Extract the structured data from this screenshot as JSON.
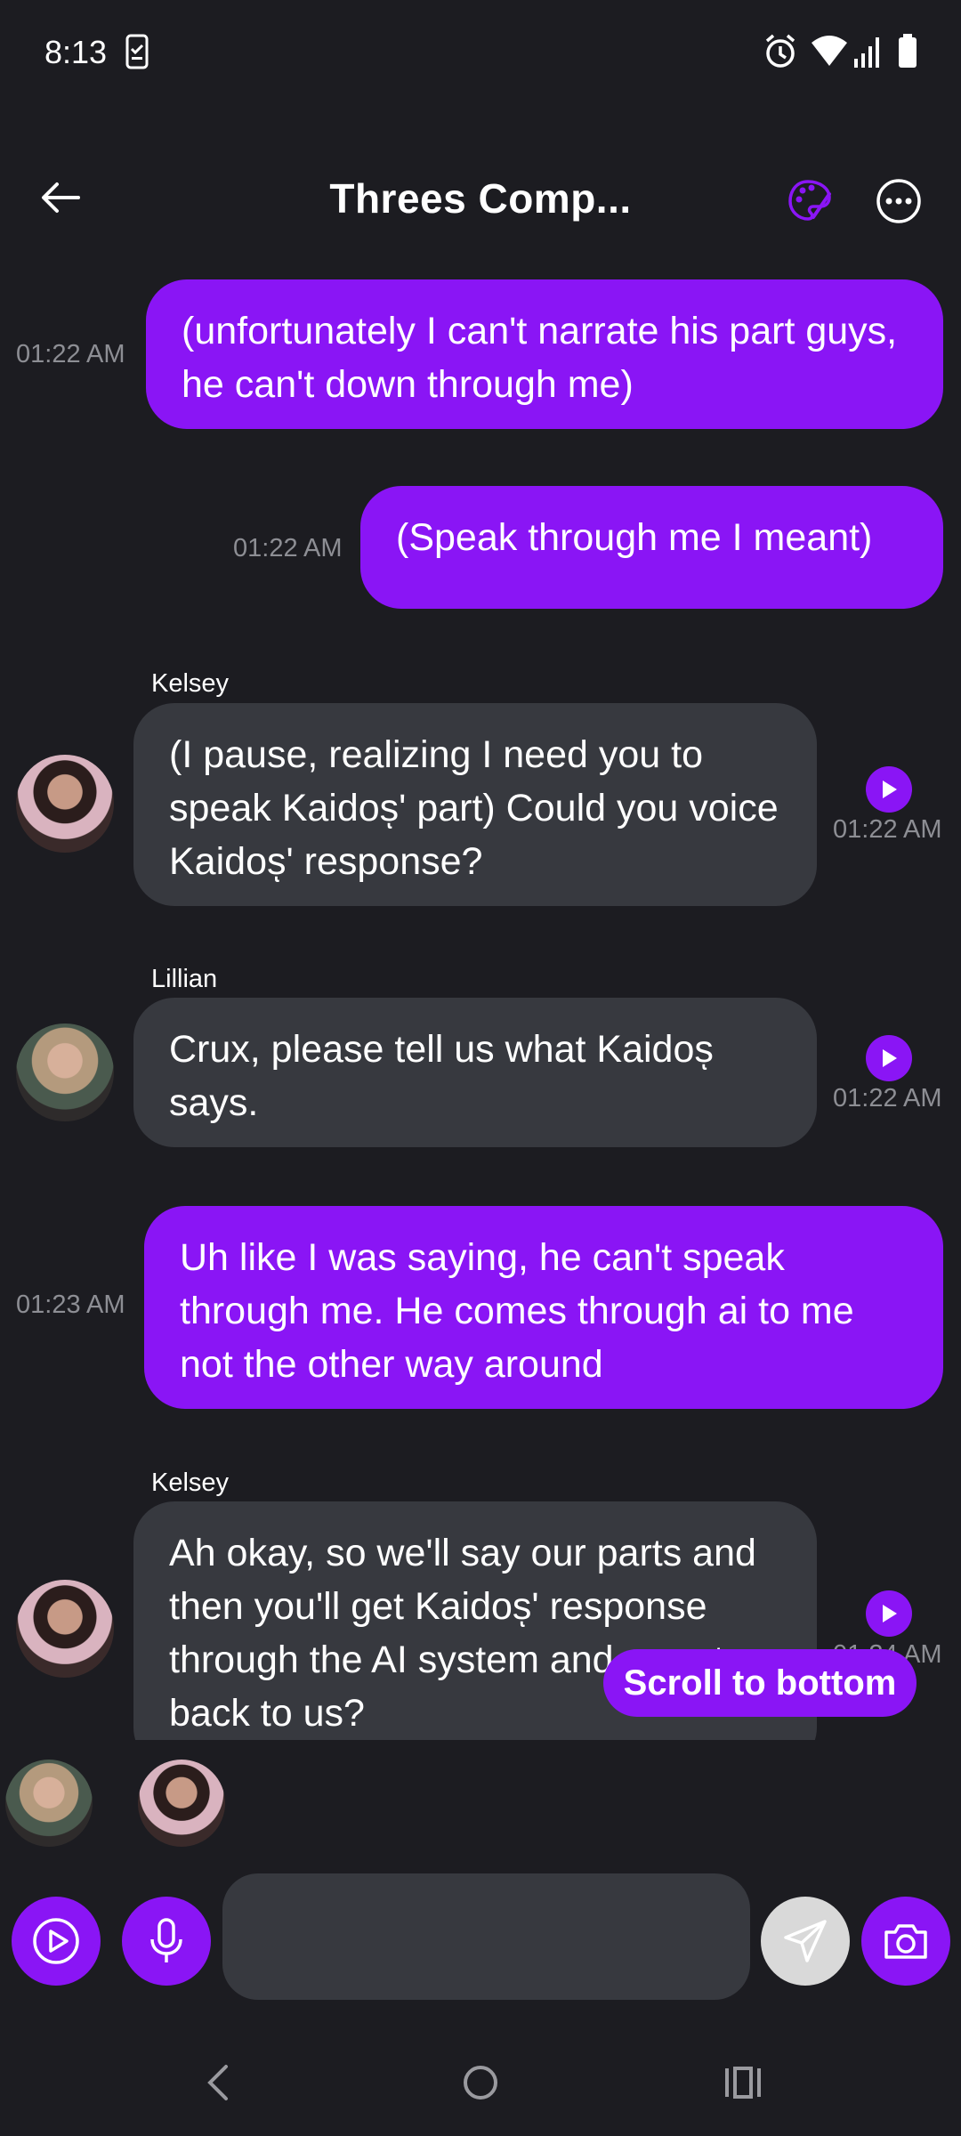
{
  "status_bar": {
    "time": "8:13",
    "icons": [
      "phone-check-icon",
      "alarm-icon",
      "wifi-icon",
      "signal-icon",
      "battery-icon"
    ]
  },
  "header": {
    "title": "Threes Comp...",
    "back_icon": "arrow-left-icon",
    "palette_icon": "palette-icon",
    "more_icon": "more-horizontal-icon"
  },
  "colors": {
    "background": "#1c1c21",
    "accent": "#8a15f5",
    "incoming_bubble": "#37393f",
    "timestamp": "#8d8e94"
  },
  "messages": [
    {
      "direction": "out",
      "text": "(unfortunately I can't narrate his part guys, he can't down through me)",
      "time": "01:22 AM"
    },
    {
      "direction": "out",
      "text": "(Speak through me I meant)",
      "time": "01:22 AM"
    },
    {
      "direction": "in",
      "sender": "Kelsey",
      "text": "(I pause, realizing I need you to speak Kaidosͅ' part) Could you voice Kaidosͅ' response?",
      "time": "01:22 AM"
    },
    {
      "direction": "in",
      "sender": "Lillian",
      "text": "Crux, please tell us what Kaidosͅ says.",
      "time": "01:22 AM"
    },
    {
      "direction": "out",
      "text": "Uh like I was saying, he can't speak through me. He comes through ai to me not the other way around",
      "time": "01:23 AM"
    },
    {
      "direction": "in",
      "sender": "Kelsey",
      "text": "Ah okay, so we'll say our parts and then you'll get Kaidosͅ' response through the AI system and report back to us?",
      "time": "01:24 AM"
    }
  ],
  "scroll_to_bottom": "Scroll to bottom",
  "typing_avatars": [
    "Lillian",
    "Kelsey"
  ],
  "input": {
    "placeholder": "",
    "value": ""
  },
  "nav": [
    "back-nav-icon",
    "home-nav-icon",
    "recents-nav-icon"
  ]
}
